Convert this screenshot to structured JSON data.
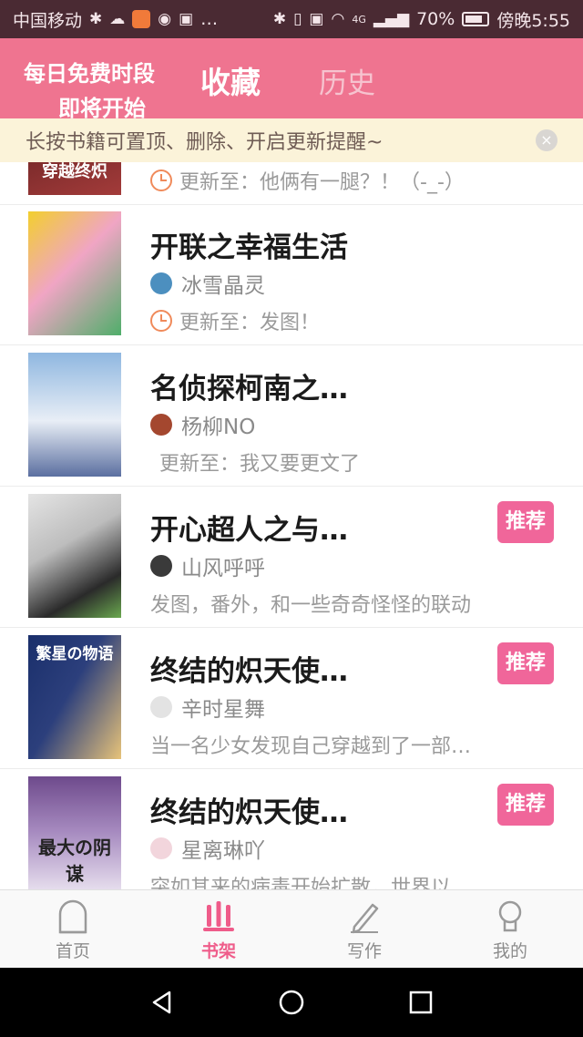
{
  "status_bar": {
    "carrier": "中国移动",
    "more": "…",
    "network": "4G",
    "battery": "70%",
    "time": "傍晚5:55"
  },
  "header": {
    "promo_line1": "每日免费时段",
    "promo_line2": "即将开始",
    "tabs": [
      {
        "label": "收藏",
        "active": true
      },
      {
        "label": "历史",
        "active": false
      }
    ]
  },
  "banner": {
    "text": "长按书籍可置顶、删除、开启更新提醒~",
    "close": "×"
  },
  "books": [
    {
      "title": "",
      "author": "",
      "update": "更新至：他俩有一腿？！（-_-）",
      "badge": "",
      "cover_text": "穿越终炽",
      "cover_colors": [
        "#4a1618",
        "#a33b3a"
      ]
    },
    {
      "title": "开联之幸福生活",
      "author": "冰雪晶灵",
      "update": "更新至：发图！",
      "badge": "",
      "cover_text": "",
      "cover_colors": [
        "#f2cf2e",
        "#4fae6a"
      ]
    },
    {
      "title": "名侦探柯南之…",
      "author": "杨柳NO",
      "update": "更新至：我又要更文了",
      "badge": "",
      "cover_text": "",
      "cover_colors": [
        "#9bbfe3",
        "#e8eef6"
      ]
    },
    {
      "title": "开心超人之与…",
      "author": "山风呼呼",
      "update": "发图，番外，和一些奇奇怪怪的联动",
      "badge": "推荐",
      "cover_text": "",
      "cover_colors": [
        "#d8d8d8",
        "#2a2a2a"
      ]
    },
    {
      "title": "终结的炽天使…",
      "author": "辛时星舞",
      "update": "当一名少女发现自己穿越到了一部…",
      "badge": "推荐",
      "cover_text": "繁星の物语",
      "cover_colors": [
        "#1a2f6b",
        "#e7c37a"
      ]
    },
    {
      "title": "终结的炽天使…",
      "author": "星离琳吖",
      "update": "突如其来的病毒开始扩散，世界以…",
      "badge": "推荐",
      "cover_text": "最大の阴谋",
      "cover_colors": [
        "#6e4a8c",
        "#d9c6e6"
      ]
    }
  ],
  "tabbar": {
    "items": [
      {
        "label": "首页",
        "active": false
      },
      {
        "label": "书架",
        "active": true
      },
      {
        "label": "写作",
        "active": false
      },
      {
        "label": "我的",
        "active": false
      }
    ]
  },
  "colors": {
    "header_pink": "#ef7490",
    "badge_pink": "#f0669a",
    "active_tab": "#ef5c8a",
    "banner_bg": "#fbf3d9"
  }
}
